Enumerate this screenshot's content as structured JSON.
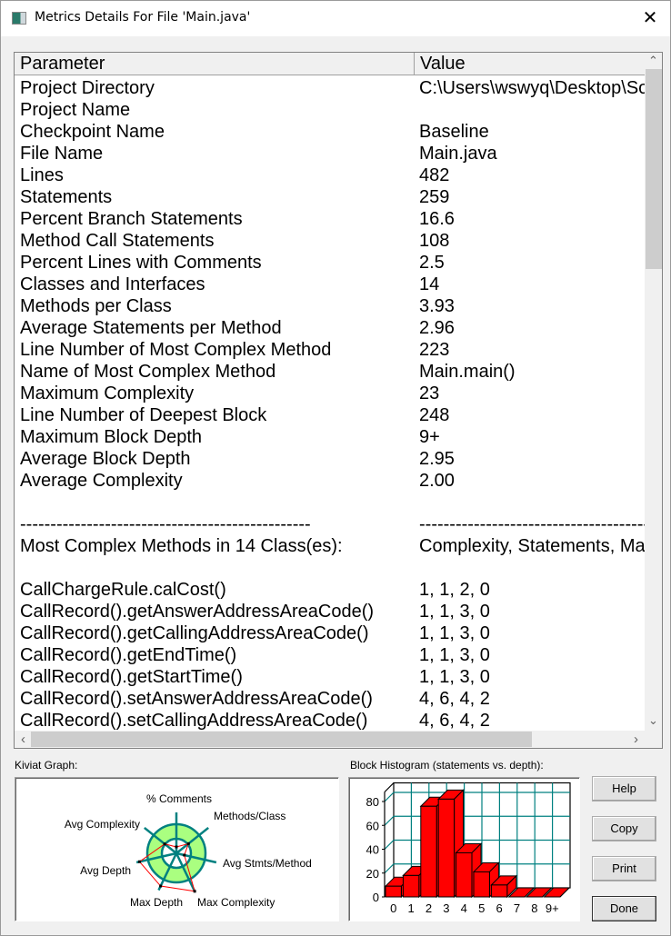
{
  "window": {
    "title": "Metrics Details For File 'Main.java'",
    "close_icon": "close-icon"
  },
  "table": {
    "columns": [
      "Parameter",
      "Value"
    ],
    "rows": [
      [
        "Project Directory",
        "C:\\Users\\wswyq\\Desktop\\So"
      ],
      [
        "Project Name",
        ""
      ],
      [
        "Checkpoint Name",
        "Baseline"
      ],
      [
        "File Name",
        "Main.java"
      ],
      [
        "Lines",
        "482"
      ],
      [
        "Statements",
        "259"
      ],
      [
        "Percent Branch Statements",
        "16.6"
      ],
      [
        "Method Call Statements",
        "108"
      ],
      [
        "Percent Lines with Comments",
        "2.5"
      ],
      [
        "Classes and Interfaces",
        "14"
      ],
      [
        "Methods per Class",
        "3.93"
      ],
      [
        "Average Statements per Method",
        "2.96"
      ],
      [
        "Line Number of Most Complex Method",
        "223"
      ],
      [
        "Name of Most Complex Method",
        "Main.main()"
      ],
      [
        "Maximum Complexity",
        "23"
      ],
      [
        "Line Number of Deepest Block",
        "248"
      ],
      [
        "Maximum Block Depth",
        "9+"
      ],
      [
        "Average Block Depth",
        "2.95"
      ],
      [
        "Average Complexity",
        "2.00"
      ],
      [
        "",
        ""
      ],
      [
        "------------------------------------------------",
        "--------------------------------------------"
      ],
      [
        "Most Complex Methods in 14 Class(es):",
        "Complexity, Statements, Max"
      ],
      [
        "",
        ""
      ],
      [
        "CallChargeRule.calCost()",
        "1, 1, 2, 0"
      ],
      [
        "CallRecord().getAnswerAddressAreaCode()",
        "1, 1, 3, 0"
      ],
      [
        "CallRecord().getCallingAddressAreaCode()",
        "1, 1, 3, 0"
      ],
      [
        "CallRecord().getEndTime()",
        "1, 1, 3, 0"
      ],
      [
        "CallRecord().getStartTime()",
        "1, 1, 3, 0"
      ],
      [
        "CallRecord().setAnswerAddressAreaCode()",
        "4, 6, 4, 2"
      ],
      [
        "CallRecord().setCallingAddressAreaCode()",
        "4, 6, 4, 2"
      ]
    ]
  },
  "kiviat": {
    "label": "Kiviat Graph:",
    "axes": [
      "% Comments",
      "Methods/Class",
      "Avg Stmts/Method",
      "Max Complexity",
      "Max Depth",
      "Avg Depth",
      "Avg Complexity"
    ],
    "levels": [
      0.44,
      1.06,
      0.56,
      2.9,
      2.5,
      2.6,
      1.03
    ],
    "normal_range": [
      1,
      2
    ],
    "colors": {
      "ring": "#aaff80",
      "spoke": "#008080",
      "plot": "#ff0000"
    }
  },
  "histogram": {
    "label": "Block Histogram (statements vs. depth):",
    "chart_data": {
      "type": "bar",
      "categories": [
        "0",
        "1",
        "2",
        "3",
        "4",
        "5",
        "6",
        "7",
        "8",
        "9+"
      ],
      "values": [
        9,
        18,
        76,
        82,
        37,
        21,
        10,
        0,
        0,
        0
      ],
      "ylim": [
        0,
        88
      ],
      "yticks": [
        "0",
        "20",
        "40",
        "60",
        "80"
      ],
      "grid": true,
      "bar_color": "#ff0000",
      "grid_color": "#008080"
    }
  },
  "buttons": {
    "help": "Help",
    "copy": "Copy",
    "print": "Print",
    "done": "Done"
  }
}
